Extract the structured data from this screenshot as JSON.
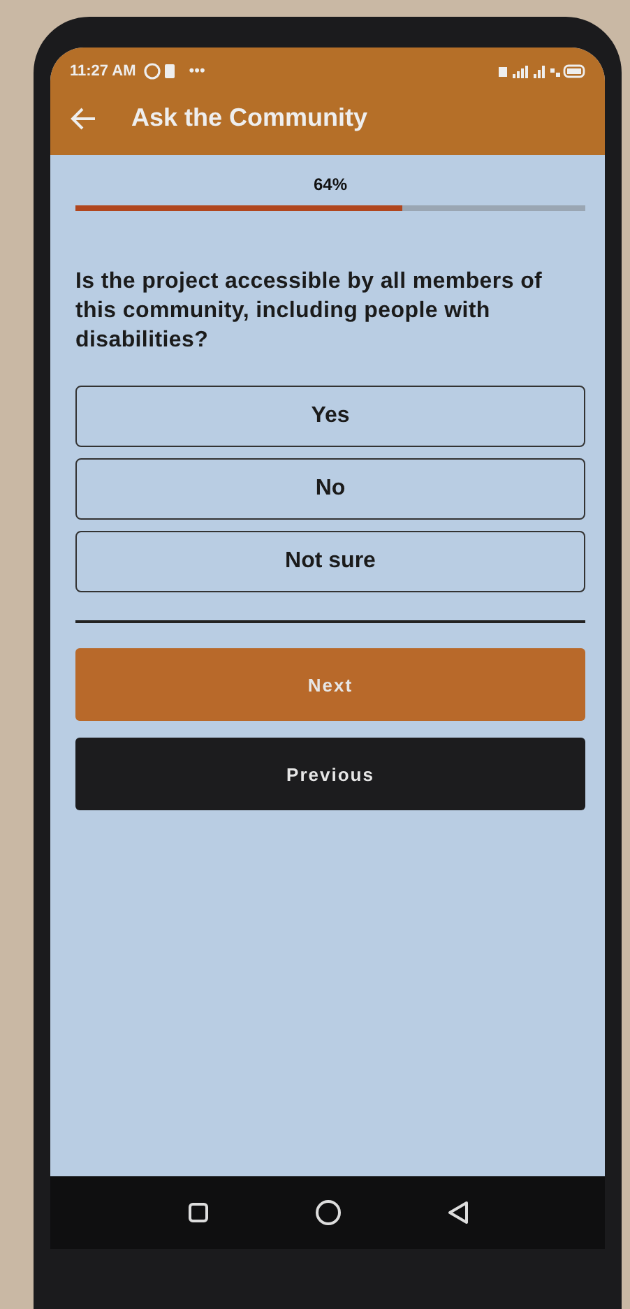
{
  "status_bar": {
    "time": "11:27 AM",
    "dots": "•••"
  },
  "app_bar": {
    "title": "Ask the Community"
  },
  "progress": {
    "reading": "64%",
    "level": 0.64
  },
  "question": "Is the project accessible by all members of this community, including people with disabilities?",
  "options": [
    {
      "label": "Yes",
      "selected": false
    },
    {
      "label": "No",
      "selected": false
    },
    {
      "label": "Not sure",
      "selected": false
    }
  ],
  "buttons": [
    {
      "label": "Next",
      "kind": "primary"
    },
    {
      "label": "Previous",
      "kind": "secondary"
    }
  ]
}
